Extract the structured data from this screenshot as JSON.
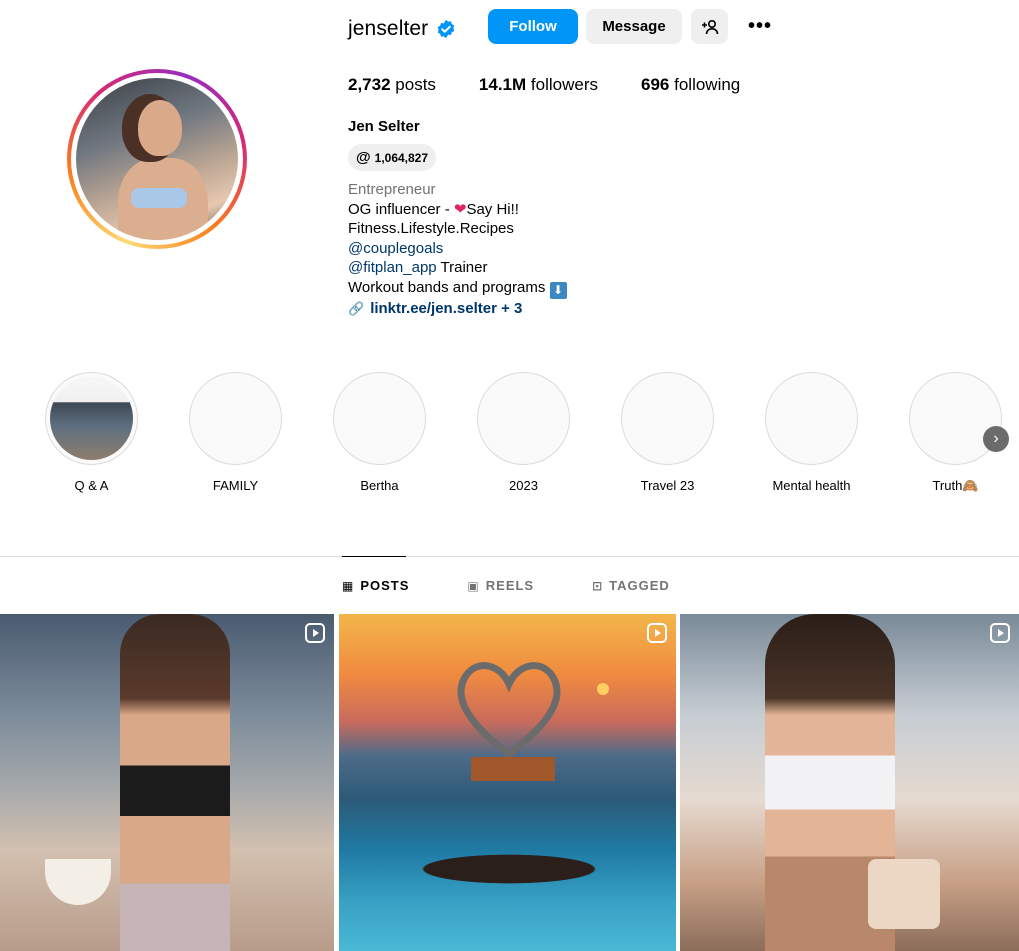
{
  "profile": {
    "username": "jenselter",
    "follow_label": "Follow",
    "message_label": "Message",
    "more_label": "•••",
    "posts_count": "2,732",
    "posts_label": "posts",
    "followers_count": "14.1M",
    "followers_label": "followers",
    "following_count": "696",
    "following_label": "following",
    "full_name": "Jen Selter",
    "threads_count": "1,064,827",
    "category": "Entrepreneur",
    "bio_line1_a": "OG influencer - ",
    "bio_line1_b": "Say Hi!!",
    "bio_line2": "Fitness.Lifestyle.Recipes",
    "bio_mention1": "@couplegoals",
    "bio_mention2": "@fitplan_app",
    "bio_mention2_suffix": " Trainer",
    "bio_line5": "Workout bands and programs",
    "link_text": "linktr.ee/jen.selter + 3"
  },
  "highlights": [
    {
      "label": "Q & A"
    },
    {
      "label": "FAMILY"
    },
    {
      "label": "Bertha"
    },
    {
      "label": "2023"
    },
    {
      "label": "Travel 23"
    },
    {
      "label": "Mental health"
    },
    {
      "label": "Truth🙈"
    }
  ],
  "tabs": [
    {
      "label": "POSTS",
      "active": true
    },
    {
      "label": "REELS",
      "active": false
    },
    {
      "label": "TAGGED",
      "active": false
    }
  ],
  "colors": {
    "accent": "#0095f6",
    "verified": "#0095f6",
    "link": "#00376b",
    "muted": "#737373"
  }
}
